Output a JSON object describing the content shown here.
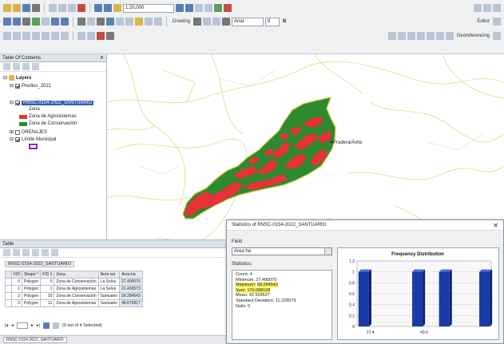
{
  "toolbar": {
    "scale_value": "1:20,000",
    "drawing_label": "Drawing",
    "font_name": "Arial",
    "font_size": "8",
    "bold_label": "B",
    "editor_label": "Editor",
    "georeferencing_label": "Georeferencing"
  },
  "toc": {
    "title": "Table Of Contents",
    "close": "✕",
    "layers_group": "Layers",
    "predios_layer": "Predios_2021",
    "rnsc_layer": "RNSC-0154-2022_SANTUARIO",
    "zona_field": "Zona",
    "legend_agrosist": "Zona de Agrosistemas",
    "legend_conserv": "Zona de Conservación",
    "drenajes_layer": "DRENAJES",
    "limite_layer": "Límite Municipal"
  },
  "map": {
    "place_label": "Pradera/Ávila"
  },
  "table": {
    "title": "Table",
    "tab_label": "RNSC-0154-2022_SANTUARIO",
    "columns": [
      "FID",
      "Shape *",
      "FID 1",
      "Zona",
      "Nom ver",
      "Área ha"
    ],
    "rows": [
      [
        "0",
        "Polygon",
        "0",
        "Zona de Conservación",
        "La Selva",
        "27.400075"
      ],
      [
        "1",
        "Polygon",
        "1",
        "Zona de Agrosistemas",
        "La Selva",
        "21.400573"
      ],
      [
        "2",
        "Polygon",
        "10",
        "Zona de Conservación",
        "Santuario",
        "58.284543"
      ],
      [
        "3",
        "Polygon",
        "11",
        "Zona de Agrosistemas",
        "Santuario",
        "48.875817"
      ]
    ],
    "record_status": "(0 out of 4 Selected)",
    "bottom_tab": "RNSC-0154-2022_SANTUARIO"
  },
  "stats": {
    "title": "Statistics of RNSC-0154-2022_SANTUARIO",
    "close": "✕",
    "field_label": "Field",
    "field_value": "Área ha",
    "statistics_label": "Statistics:",
    "lines": [
      {
        "label": "Count:",
        "value": "4"
      },
      {
        "label": "Minimum:",
        "value": "27.400075"
      },
      {
        "label": "Maximum:",
        "value": "58.284543"
      },
      {
        "label": "Sum:",
        "value": "170.098109"
      },
      {
        "label": "Mean:",
        "value": "42.524527"
      },
      {
        "label": "Standard Deviation:",
        "value": "11.228579"
      },
      {
        "label": "Nulls:",
        "value": "0"
      }
    ],
    "freq_title": "Frequency Distribution",
    "y_ticks": [
      "0",
      "0.2",
      "0.4",
      "0.6",
      "0.8",
      "1",
      "1.2"
    ],
    "x_ticks": [
      "27.4",
      "43.6"
    ]
  },
  "chart_data": {
    "type": "bar",
    "title": "Frequency Distribution",
    "categories": [
      "b1",
      "b2",
      "b3",
      "b4",
      "b5",
      "b6",
      "b7",
      "b8",
      "b9",
      "b10"
    ],
    "values": [
      1,
      0,
      0,
      0,
      1,
      0,
      1,
      0,
      0,
      1
    ],
    "ylim": [
      0,
      1.2
    ],
    "x_tick_labels": [
      "27.4",
      "43.6"
    ]
  },
  "colors": {
    "agro": "#e8323a",
    "conserv": "#2d8a2f",
    "bar": "#1a3aa8",
    "road": "#e3d98a"
  }
}
